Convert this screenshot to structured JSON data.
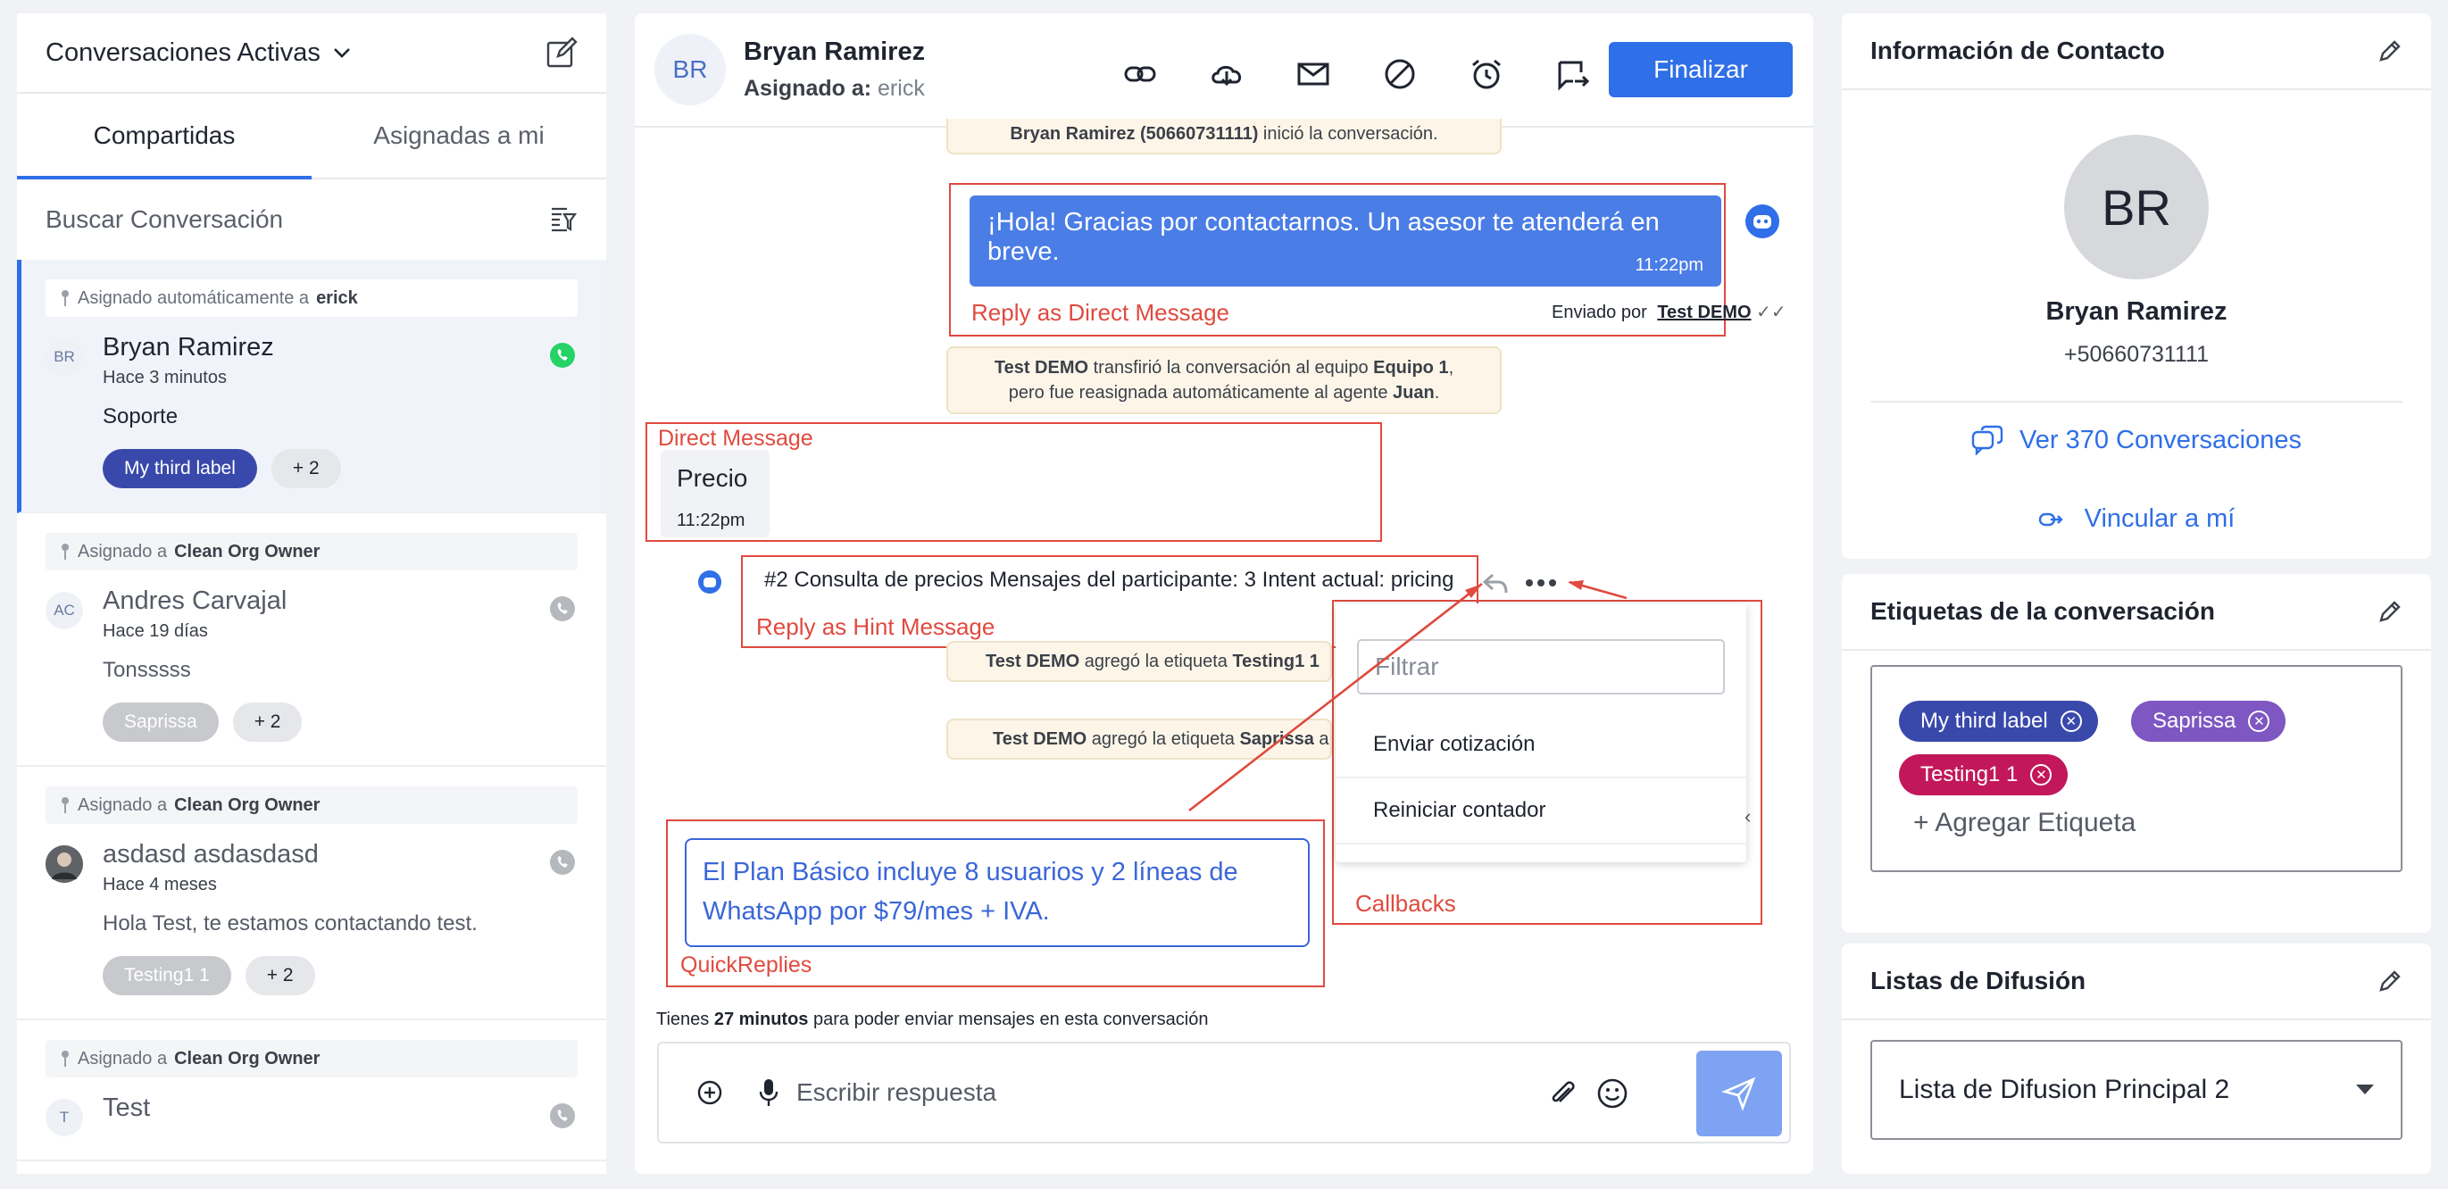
{
  "left": {
    "title": "Conversaciones Activas",
    "tabs": [
      "Compartidas",
      "Asignadas a mi"
    ],
    "search_placeholder": "Buscar Conversación",
    "conversations": [
      {
        "assigned_prefix": "Asignado automáticamente a",
        "assigned_to": "erick",
        "initials": "BR",
        "name": "Bryan Ramirez",
        "time": "Hace 3 minutos",
        "preview": "Soporte",
        "label": "My third label",
        "more": "+ 2"
      },
      {
        "assigned_prefix": "Asignado a",
        "assigned_to": "Clean Org Owner",
        "initials": "AC",
        "name": "Andres Carvajal",
        "time": "Hace 19 días",
        "preview": "Tonsssss",
        "label": "Saprissa",
        "more": "+ 2"
      },
      {
        "assigned_prefix": "Asignado a",
        "assigned_to": "Clean Org Owner",
        "initials": "",
        "name": "asdasd asdasdasd",
        "time": "Hace 4 meses",
        "preview": "Hola Test, te estamos contactando test.",
        "label": "Testing1 1",
        "more": "+ 2"
      },
      {
        "assigned_prefix": "Asignado a",
        "assigned_to": "Clean Org Owner",
        "initials": "T",
        "name": "Test",
        "time": "",
        "preview": "",
        "label": "",
        "more": ""
      }
    ]
  },
  "chat": {
    "initials": "BR",
    "name": "Bryan Ramirez",
    "assigned_label": "Asignado a:",
    "assigned_value": "erick",
    "finish_button": "Finalizar",
    "sys1_name": "Bryan Ramirez (50660731111)",
    "sys1_rest": " inició la conversación.",
    "out_message": "¡Hola! Gracias por contactarnos. Un asesor te atenderá en breve.",
    "out_time": "11:22pm",
    "sent_by_label": "Enviado por",
    "sent_by_name": "Test DEMO",
    "sys2_line1_a": "Test DEMO",
    "sys2_line1_b": " transfirió la conversación al equipo ",
    "sys2_line1_c": "Equipo 1",
    "sys2_line1_d": ",",
    "sys2_line2_a": "pero fue reasignada automáticamente al agente ",
    "sys2_line2_b": "Juan",
    "sys2_line2_c": ".",
    "in_message": "Precio",
    "in_time": "11:22pm",
    "hint_message": "#2 Consulta de precios Mensajes del participante: 3 Intent actual: pricing",
    "sys3_a": "Test DEMO",
    "sys3_b": " agregó la etiqueta ",
    "sys3_c": "Testing1 1",
    "sys3_d": " a",
    "sys4_a": "Test DEMO",
    "sys4_b": " agregó la etiqueta ",
    "sys4_c": "Saprissa",
    "sys4_d": " a",
    "popup_filter_placeholder": "Filtrar",
    "popup_items": [
      "Enviar cotización",
      "Reiniciar contador"
    ],
    "quick_reply": "El Plan Básico incluye 8 usuarios y 2 líneas de WhatsApp por $79/mes + IVA.",
    "timer_a": "Tienes ",
    "timer_b": "27 minutos",
    "timer_c": " para poder enviar mensajes en esta conversación",
    "composer_placeholder": "Escribir respuesta"
  },
  "annotations": {
    "reply_direct": "Reply as Direct Message",
    "direct": "Direct Message",
    "reply_hint": "Reply as Hint Message",
    "quick": "QuickReplies",
    "callbacks": "Callbacks"
  },
  "contact": {
    "title": "Información de Contacto",
    "initials": "BR",
    "name": "Bryan Ramirez",
    "phone": "+50660731111",
    "view_conversations": "Ver 370 Conversaciones",
    "link_me": "Vincular a mí"
  },
  "tags": {
    "title": "Etiquetas de la conversación",
    "items": [
      {
        "label": "My third label",
        "color": "#3949ab"
      },
      {
        "label": "Saprissa",
        "color": "#7e57c2"
      },
      {
        "label": "Testing1 1",
        "color": "#c2185b"
      }
    ],
    "add_label": "+ Agregar Etiqueta"
  },
  "lists": {
    "title": "Listas de Difusión",
    "selected": "Lista de Difusion Principal 2"
  },
  "colors": {
    "accent": "#2f6fe8",
    "annotation": "#e04a3f",
    "whatsapp": "#25d366"
  }
}
